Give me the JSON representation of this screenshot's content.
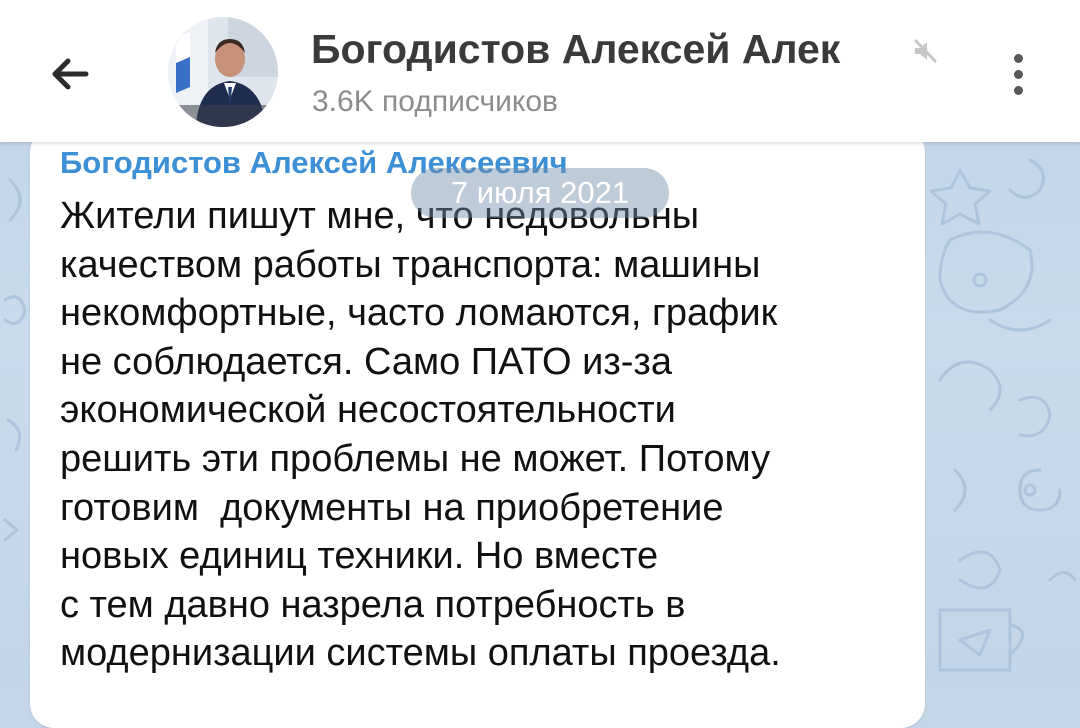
{
  "header": {
    "back_icon": "arrow-left-icon",
    "channel_title": "Богодистов Алексей Алек",
    "muted_icon": "speaker-muted-icon",
    "subscribers": "3.6K подписчиков",
    "menu_icon": "more-vertical-icon"
  },
  "date_badge": "7 июля 2021",
  "message": {
    "author": "Богодистов Алексей Алексеевич",
    "lines": [
      "Жители пишут мне, что недовольны",
      "качеством работы транспорта: машины",
      "некомфортные, часто ломаются, график",
      "не соблюдается. Само ПАТО из-за",
      "экономической несостоятельности",
      "решить эти проблемы не может. Потому",
      "готовим  документы на приобретение",
      "новых единиц техники. Но вместе",
      "с тем давно назрела потребность в",
      "модернизации системы оплаты проезда."
    ]
  },
  "colors": {
    "author": "#3d8fd6",
    "chat_background": "#c5d6e8",
    "bubble": "#ffffff",
    "header": "#ffffff"
  }
}
